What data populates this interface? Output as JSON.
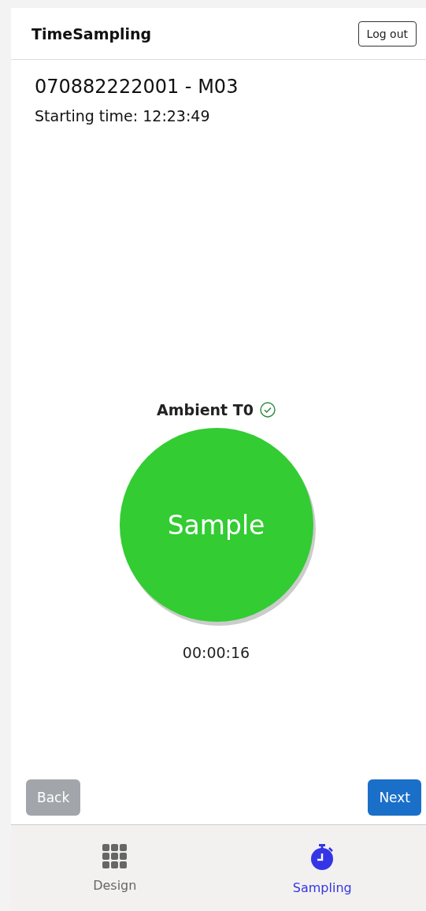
{
  "header": {
    "title": "TimeSampling",
    "logout_button": "Log out"
  },
  "sample": {
    "id": "070882222001 - M03",
    "starting_time": "Starting time: 12:23:49"
  },
  "step": {
    "label": "Ambient T0",
    "done": true,
    "button": "Sample",
    "elapsed": "00:00:16"
  },
  "actions": [
    {
      "label": "Back",
      "disabled": true
    },
    {
      "label": "Next",
      "disabled": false
    }
  ],
  "tabs": [
    {
      "label": "Design",
      "kind": "grid",
      "selected": false
    },
    {
      "label": "Sampling",
      "kind": "stopwatch",
      "selected": true
    }
  ]
}
